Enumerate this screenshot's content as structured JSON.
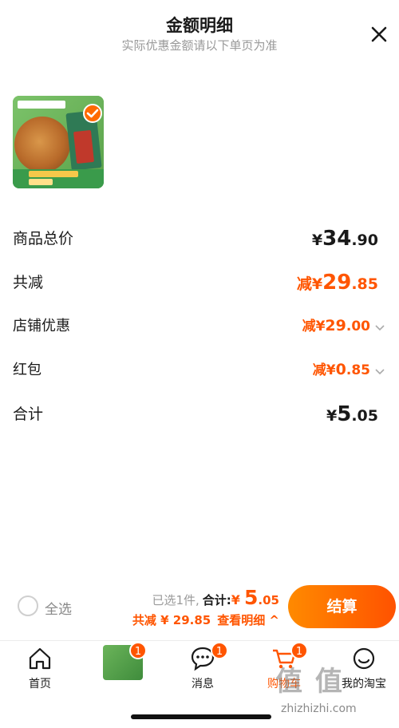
{
  "header": {
    "title": "金额明细",
    "subtitle": "实际优惠金额请以下单页为准"
  },
  "rows": {
    "total": {
      "label": "商品总价",
      "currency": "¥",
      "int": "34",
      "dec": ".90"
    },
    "discount": {
      "label": "共减",
      "prefix": "减",
      "currency": "¥",
      "int": "29",
      "dec": ".85"
    },
    "shop": {
      "label": "店铺优惠",
      "prefix": "减",
      "currency": "¥",
      "int": "29",
      "dec": ".00"
    },
    "hongbao": {
      "label": "红包",
      "prefix": "减",
      "currency": "¥",
      "int": "0",
      "dec": ".85"
    },
    "sum": {
      "label": "合计",
      "currency": "¥",
      "int": "5",
      "dec": ".05"
    }
  },
  "bottom": {
    "select_all": "全选",
    "selected_text": "已选1件,",
    "total_label": "合计:",
    "currency": "¥",
    "total_int": "5",
    "total_dec": ".05",
    "saved_label": "共减 ¥ 29.85",
    "detail_link": "查看明细 ^",
    "checkout": "结算"
  },
  "tabs": {
    "home": "首页",
    "thumb_badge": "1",
    "messages": "消息",
    "messages_badge": "1",
    "cart": "购物车",
    "cart_badge": "1",
    "me": "我的淘宝"
  },
  "watermark": {
    "logo": "值 值",
    "site": "zhizhizhi.com"
  },
  "colors": {
    "accent": "#ff5500",
    "checkout_start": "#ff8a00",
    "checkout_end": "#ff5200"
  }
}
